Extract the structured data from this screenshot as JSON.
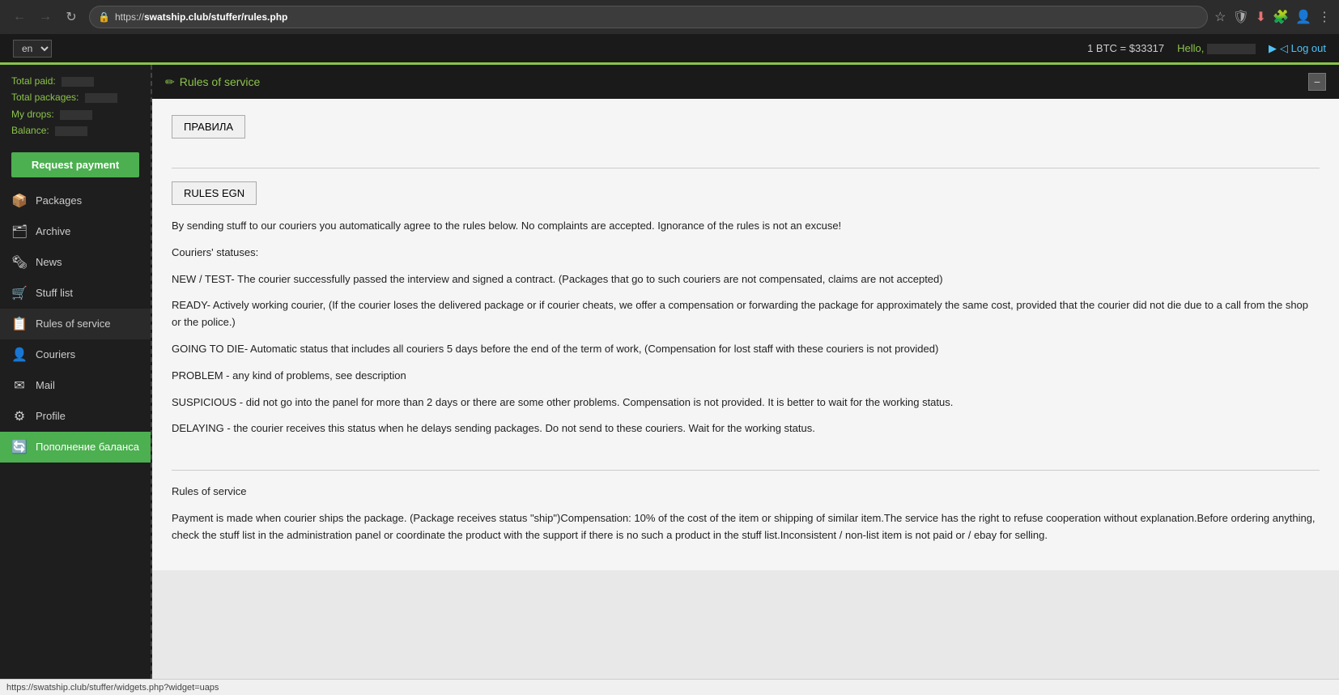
{
  "browser": {
    "url_domain": "swatship.club",
    "url_path": "/stuffer/rules.php",
    "url_protocol": "https://"
  },
  "topbar": {
    "lang": "en",
    "btc_price": "1 BTC = $33317",
    "hello_label": "Hello,",
    "logout_label": "◁ Log out"
  },
  "sidebar": {
    "stats": {
      "total_paid_label": "Total paid:",
      "total_packages_label": "Total packages:",
      "my_drops_label": "My drops:",
      "balance_label": "Balance:"
    },
    "request_payment_label": "Request payment",
    "nav_items": [
      {
        "id": "packages",
        "icon": "📦",
        "label": "Packages"
      },
      {
        "id": "archive",
        "icon": "🗂",
        "label": "Archive"
      },
      {
        "id": "news",
        "icon": "🗞",
        "label": "News"
      },
      {
        "id": "stuff-list",
        "icon": "🛒",
        "label": "Stuff list"
      },
      {
        "id": "rules",
        "icon": "📋",
        "label": "Rules of service",
        "active": true
      },
      {
        "id": "couriers",
        "icon": "👤",
        "label": "Couriers"
      },
      {
        "id": "mail",
        "icon": "✉",
        "label": "Mail"
      },
      {
        "id": "profile",
        "icon": "⚙",
        "label": "Profile"
      },
      {
        "id": "balance",
        "icon": "🔄",
        "label": "Пополнение баланса",
        "green": true
      }
    ]
  },
  "rules_page": {
    "header_title": "Rules of service",
    "minimize_symbol": "−",
    "pravila_btn": "ПРАВИЛА",
    "rules_egn_btn": "RULES EGN",
    "intro_text": "By sending stuff to our couriers you automatically agree to the rules below. No complaints are accepted.  Ignorance of the rules is not an excuse!",
    "couriers_statuses_label": "Couriers' statuses:",
    "status_new": "NEW / TEST- The courier successfully passed the interview and signed a contract. (Packages that go to such couriers are not compensated, claims are not accepted)",
    "status_ready": "READY- Actively working courier, (If the courier loses the delivered package or if courier cheats, we offer a compensation or forwarding the package for approximately the same cost, provided that the courier did not die due to a call from the shop or the police.)",
    "status_going_to_die": "GOING TO DIE- Automatic status that includes all couriers 5 days before the end of the term of work, (Compensation for lost staff with these couriers is not provided)",
    "status_problem": "PROBLEM - any kind of problems, see description",
    "status_suspicious": "SUSPICIOUS - did not go into the panel for more than 2 days or there are some other problems. Compensation is not provided. It is better to wait for the working status.",
    "status_delaying": "DELAYING - the courier receives this status when he delays sending packages. Do not send to these couriers. Wait for the working status.",
    "rules_of_service_label": "Rules of service",
    "payment_text": "Payment is made when courier ships the package. (Package receives status \"ship\")Compensation: 10% of the cost of the item or shipping of similar item.The service has the right to refuse cooperation without explanation.Before ordering anything, check the stuff list in the administration panel or coordinate the product with the support if there is no such a product in the stuff list.Inconsistent / non-list item is not paid or / ebay for  selling."
  },
  "statusbar": {
    "url": "https://swatship.club/stuffer/widgets.php?widget=uaps"
  }
}
